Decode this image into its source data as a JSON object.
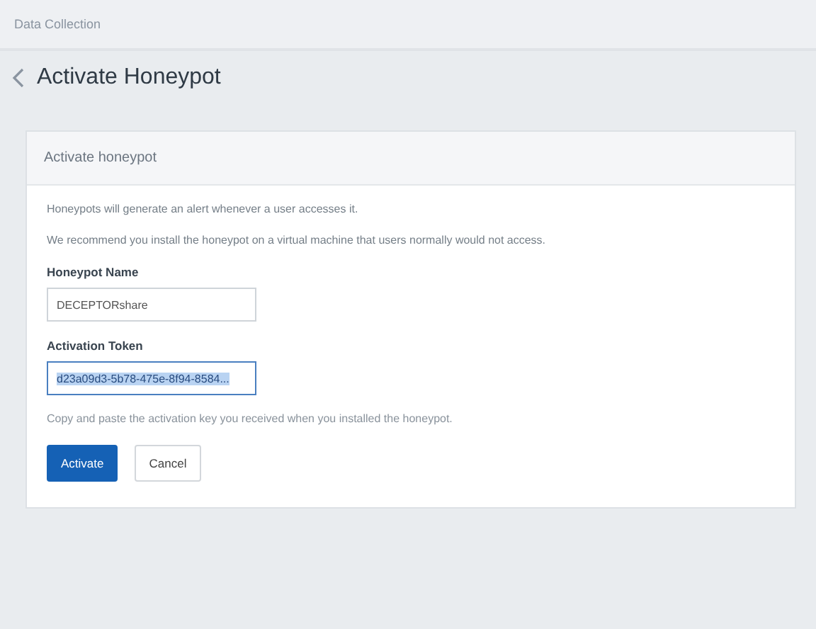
{
  "breadcrumb": "Data Collection",
  "page_title": "Activate Honeypot",
  "card": {
    "title": "Activate honeypot",
    "intro": [
      "Honeypots will generate an alert whenever a user accesses it.",
      "We recommend you install the honeypot on a virtual machine that users normally would not access."
    ],
    "fields": [
      {
        "label": "Honeypot Name",
        "value": "DECEPTORshare",
        "focused": false,
        "text_selected": false
      },
      {
        "label": "Activation Token",
        "value": "d23a09d3-5b78-475e-8f94-8584...",
        "focused": true,
        "text_selected": true
      }
    ],
    "help": "Copy and paste the activation key you received when you installed the honeypot.",
    "buttons": [
      {
        "label": "Activate",
        "kind": "primary"
      },
      {
        "label": "Cancel",
        "kind": "secondary"
      }
    ]
  }
}
